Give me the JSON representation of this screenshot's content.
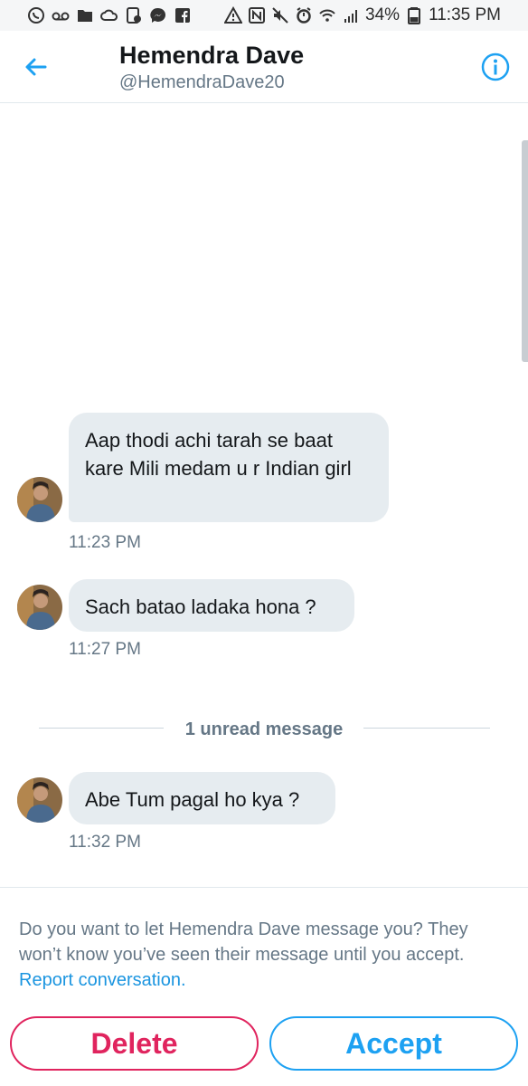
{
  "status_bar": {
    "battery": "34%",
    "time": "11:35 PM",
    "left_icons": [
      "whatsapp-icon",
      "voicemail-icon",
      "folder-icon",
      "cloud-icon",
      "screenshot-icon",
      "messenger-icon",
      "facebook-icon"
    ],
    "right_icons": [
      "warning-icon",
      "nfc-icon",
      "mute-icon",
      "alarm-icon",
      "wifi-icon",
      "signal-icon",
      "battery-icon"
    ]
  },
  "header": {
    "title": "Hemendra Dave",
    "handle": "@HemendraDave20"
  },
  "messages": [
    {
      "text": "Aap thodi achi tarah se baat kare Mili medam u r Indian girl",
      "time": "11:23 PM"
    },
    {
      "text": "Sach batao ladaka hona ?",
      "time": "11:27 PM"
    },
    {
      "text": "Abe Tum pagal ho kya ?",
      "time": "11:32 PM"
    }
  ],
  "unread_divider": "1 unread message",
  "request": {
    "prompt": "Do you want to let Hemendra Dave message you? They won’t know you’ve seen their message until you accept.",
    "report_link": "Report conversation.",
    "delete_label": "Delete",
    "accept_label": "Accept"
  },
  "colors": {
    "accent": "#1da1f2",
    "delete": "#e0245e",
    "bubble": "#e6ecf0",
    "secondary_text": "#657786"
  }
}
